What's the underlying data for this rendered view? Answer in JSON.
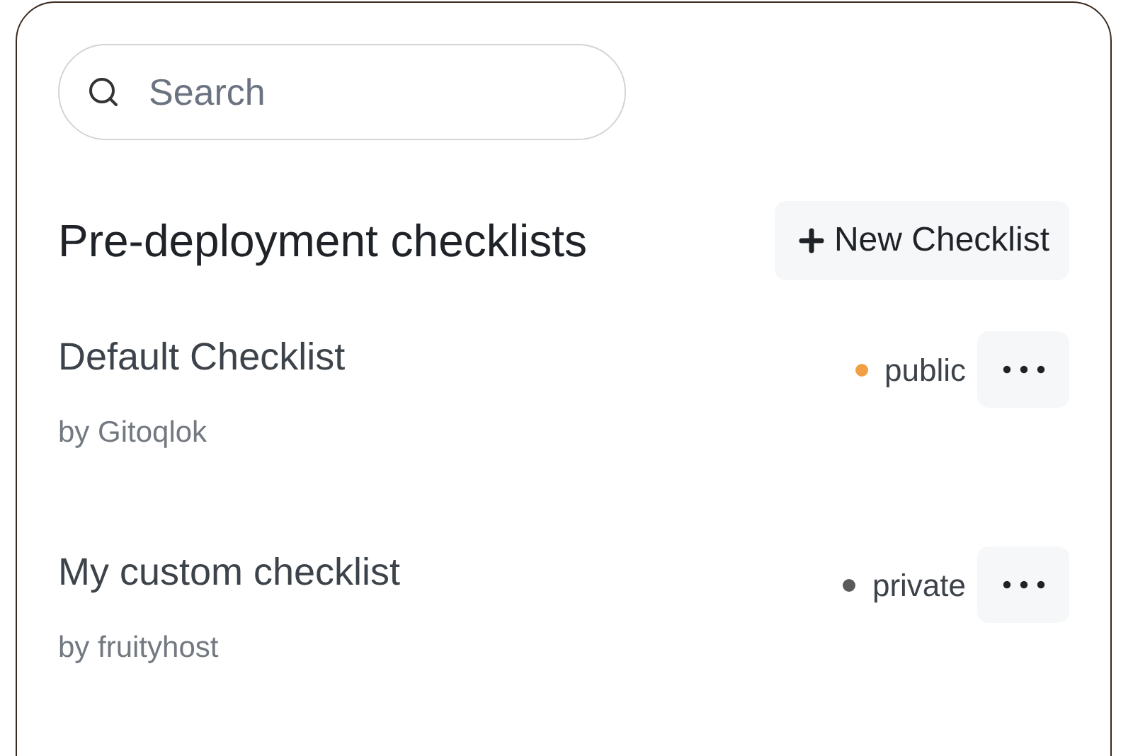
{
  "search": {
    "placeholder": "Search"
  },
  "section": {
    "title": "Pre-deployment checklists",
    "new_button": "New Checklist"
  },
  "checklists": [
    {
      "name": "Default Checklist",
      "author": "by Gitoqlok",
      "visibility": "public",
      "color": "#f0a042"
    },
    {
      "name": "My custom checklist",
      "author": "by fruityhost",
      "visibility": "private",
      "color": "#5a5a5a"
    }
  ]
}
